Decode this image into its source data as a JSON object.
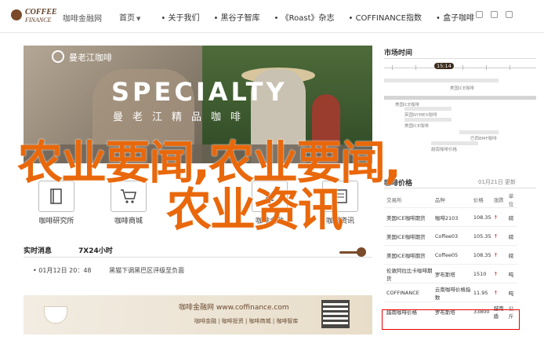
{
  "header": {
    "logo_line1": "COFFEE",
    "logo_line2": "FINANCE",
    "brand": "咖啡金融网",
    "nav": [
      {
        "label": "首页",
        "caret": "▼"
      },
      {
        "label": "• 关于我们"
      },
      {
        "label": "• 黑谷子智库"
      },
      {
        "label": "• 《Roast》杂志"
      },
      {
        "label": "• COFFINANCE指数"
      },
      {
        "label": "• 盒子咖啡"
      }
    ]
  },
  "banner": {
    "logo_text": "曼老江咖啡",
    "headline": "SPECIALTY",
    "subline": "曼老江精品咖啡"
  },
  "categories": [
    {
      "label": "咖啡研究所",
      "icon": "book-icon"
    },
    {
      "label": "咖啡商城",
      "icon": "cart-icon"
    },
    {
      "label": "咖啡金融",
      "icon": "yen-icon"
    },
    {
      "label": "咖啡资讯",
      "icon": "news-icon"
    }
  ],
  "live": {
    "tab1": "实时消息",
    "tab2": "7X24小时",
    "news": [
      {
        "date": "• 01月12日 20：48",
        "text": "黑猫下调黑巴区评级至负面"
      }
    ]
  },
  "ad": {
    "title": "咖啡金融网 www.coffinance.com",
    "links": "咖啡金融 | 咖啡投资 | 咖啡商城 | 咖啡智库"
  },
  "timeline": {
    "title": "市场时间",
    "current": "15:14",
    "events": [
      "美国ICE咖啡",
      "美国ICE咖啡",
      "英国NYMEX咖啡",
      "美国ICE咖啡",
      "巴西BMF咖啡",
      "越南咖啡价格"
    ]
  },
  "prices": {
    "title": "咖啡价格",
    "date": "01月21日 更新",
    "headers": [
      "交易所",
      "品种",
      "价格",
      "涨跌",
      "单位"
    ],
    "rows": [
      [
        "美国ICE咖啡期货",
        "咖啡2103",
        "108.35",
        "↑",
        "磅"
      ],
      [
        "美国ICE咖啡期货",
        "Coffee03",
        "105.35",
        "↑",
        "磅"
      ],
      [
        "美国ICE咖啡期货",
        "Coffee05",
        "108.35",
        "↑",
        "磅"
      ],
      [
        "伦敦阿拉比卡咖啡期货",
        "罗布斯塔",
        "1510",
        "↑",
        "吨"
      ],
      [
        "COFFINANCE",
        "云南咖啡价格指数",
        "11.95",
        "↑",
        "吨"
      ],
      [
        "越南咖啡价格",
        "罗布斯塔",
        "33800",
        "越南盾",
        "公斤"
      ]
    ]
  },
  "overlay": {
    "line1": "农业要闻,农业要闻,",
    "line2": "农业资讯"
  }
}
